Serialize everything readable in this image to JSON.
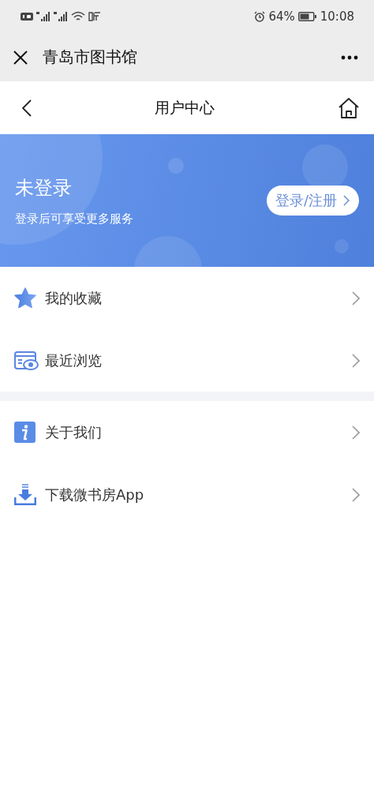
{
  "status_bar": {
    "battery": "64%",
    "time": "10:08"
  },
  "title_bar": {
    "title": "青岛市图书馆"
  },
  "nav_bar": {
    "title": "用户中心"
  },
  "profile": {
    "name": "未登录",
    "hint": "登录后可享受更多服务",
    "login_button": "登录/注册"
  },
  "menu_sections": [
    [
      {
        "kind": "star",
        "label": "我的收藏"
      },
      {
        "kind": "history",
        "label": "最近浏览"
      }
    ],
    [
      {
        "kind": "info",
        "label": "关于我们"
      },
      {
        "kind": "download",
        "label": "下载微书房App"
      }
    ]
  ]
}
